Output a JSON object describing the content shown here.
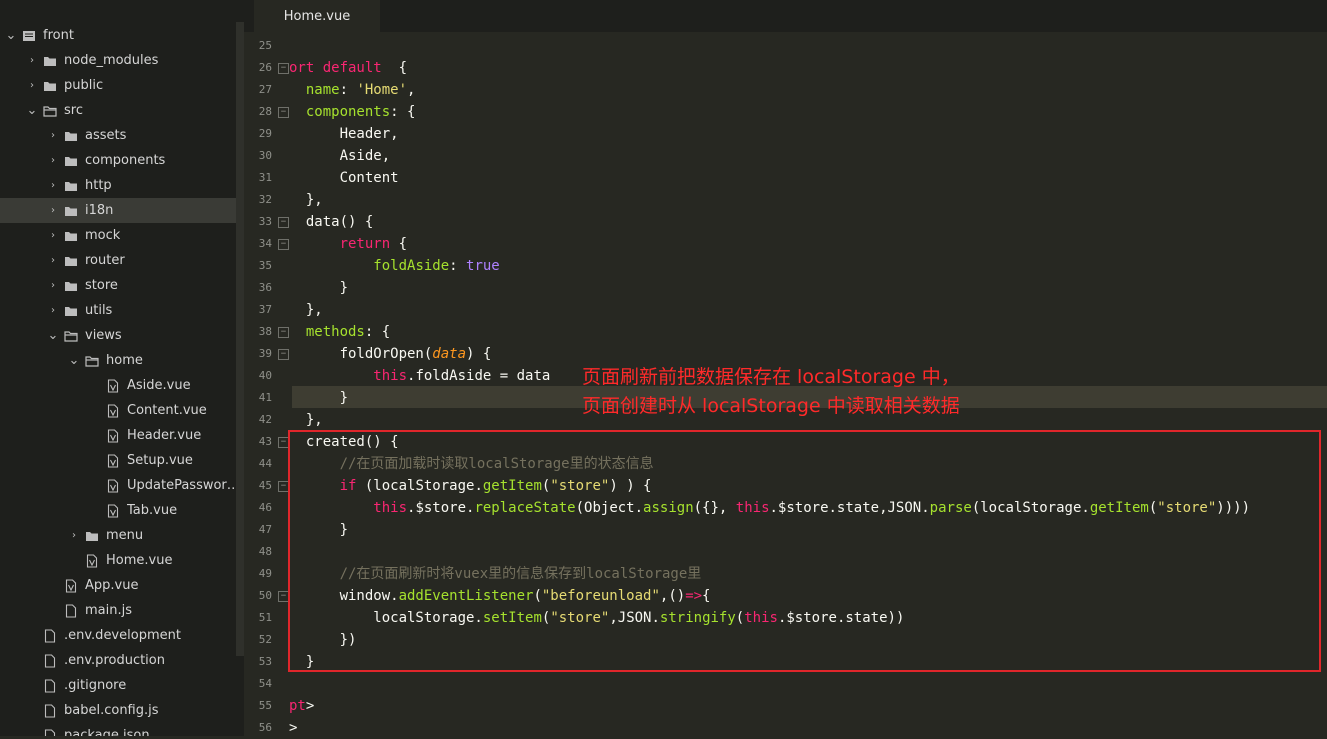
{
  "colors": {
    "annotation": "#ff2a2a",
    "highlight_box": "#e0262b",
    "editor_bg": "#272822",
    "sidebar_bg": "#1e1f1c"
  },
  "tab": {
    "label": "Home.vue"
  },
  "tree": [
    {
      "label": "front",
      "depth": 0,
      "expanded": true,
      "type": "root"
    },
    {
      "label": "node_modules",
      "depth": 1,
      "expanded": false,
      "type": "folder"
    },
    {
      "label": "public",
      "depth": 1,
      "expanded": false,
      "type": "folder"
    },
    {
      "label": "src",
      "depth": 1,
      "expanded": true,
      "type": "folder"
    },
    {
      "label": "assets",
      "depth": 2,
      "expanded": false,
      "type": "folder"
    },
    {
      "label": "components",
      "depth": 2,
      "expanded": false,
      "type": "folder"
    },
    {
      "label": "http",
      "depth": 2,
      "expanded": false,
      "type": "folder"
    },
    {
      "label": "i18n",
      "depth": 2,
      "expanded": false,
      "type": "folder",
      "selected": true
    },
    {
      "label": "mock",
      "depth": 2,
      "expanded": false,
      "type": "folder"
    },
    {
      "label": "router",
      "depth": 2,
      "expanded": false,
      "type": "folder"
    },
    {
      "label": "store",
      "depth": 2,
      "expanded": false,
      "type": "folder"
    },
    {
      "label": "utils",
      "depth": 2,
      "expanded": false,
      "type": "folder"
    },
    {
      "label": "views",
      "depth": 2,
      "expanded": true,
      "type": "folder"
    },
    {
      "label": "home",
      "depth": 3,
      "expanded": true,
      "type": "folder"
    },
    {
      "label": "Aside.vue",
      "depth": 4,
      "type": "vue"
    },
    {
      "label": "Content.vue",
      "depth": 4,
      "type": "vue"
    },
    {
      "label": "Header.vue",
      "depth": 4,
      "type": "vue"
    },
    {
      "label": "Setup.vue",
      "depth": 4,
      "type": "vue"
    },
    {
      "label": "UpdatePasswor…",
      "depth": 4,
      "type": "vue"
    },
    {
      "label": "Tab.vue",
      "depth": 4,
      "type": "vue"
    },
    {
      "label": "menu",
      "depth": 3,
      "expanded": false,
      "type": "folder"
    },
    {
      "label": "Home.vue",
      "depth": 3,
      "type": "vue"
    },
    {
      "label": "App.vue",
      "depth": 2,
      "type": "vue"
    },
    {
      "label": "main.js",
      "depth": 2,
      "type": "file"
    },
    {
      "label": ".env.development",
      "depth": 1,
      "type": "file"
    },
    {
      "label": ".env.production",
      "depth": 1,
      "type": "file"
    },
    {
      "label": ".gitignore",
      "depth": 1,
      "type": "file"
    },
    {
      "label": "babel.config.js",
      "depth": 1,
      "type": "file"
    },
    {
      "label": "package.json",
      "depth": 1,
      "type": "file"
    }
  ],
  "code_lines": [
    {
      "n": "25",
      "fold": false,
      "tokens": []
    },
    {
      "n": "26",
      "fold": true,
      "tokens": [
        [
          "kw",
          "ort default"
        ],
        [
          "",
          "  {"
        ]
      ]
    },
    {
      "n": "27",
      "fold": false,
      "tokens": [
        [
          "",
          "  "
        ],
        [
          "prop",
          "name"
        ],
        [
          "",
          ": "
        ],
        [
          "str",
          "'Home'"
        ],
        [
          "",
          ","
        ]
      ]
    },
    {
      "n": "28",
      "fold": true,
      "tokens": [
        [
          "",
          "  "
        ],
        [
          "prop",
          "components"
        ],
        [
          "",
          ": {"
        ]
      ]
    },
    {
      "n": "29",
      "fold": false,
      "tokens": [
        [
          "",
          "      Header,"
        ]
      ]
    },
    {
      "n": "30",
      "fold": false,
      "tokens": [
        [
          "",
          "      Aside,"
        ]
      ]
    },
    {
      "n": "31",
      "fold": false,
      "tokens": [
        [
          "",
          "      Content"
        ]
      ]
    },
    {
      "n": "32",
      "fold": false,
      "tokens": [
        [
          "",
          "  },"
        ]
      ]
    },
    {
      "n": "33",
      "fold": true,
      "tokens": [
        [
          "",
          "  data() {"
        ]
      ]
    },
    {
      "n": "34",
      "fold": true,
      "tokens": [
        [
          "",
          "      "
        ],
        [
          "kw",
          "return"
        ],
        [
          "",
          " {"
        ]
      ]
    },
    {
      "n": "35",
      "fold": false,
      "tokens": [
        [
          "",
          "          "
        ],
        [
          "prop",
          "foldAside"
        ],
        [
          "",
          ": "
        ],
        [
          "num",
          "true"
        ]
      ]
    },
    {
      "n": "36",
      "fold": false,
      "tokens": [
        [
          "",
          "      }"
        ]
      ]
    },
    {
      "n": "37",
      "fold": false,
      "tokens": [
        [
          "",
          "  },"
        ]
      ]
    },
    {
      "n": "38",
      "fold": true,
      "tokens": [
        [
          "",
          "  "
        ],
        [
          "prop",
          "methods"
        ],
        [
          "",
          ": {"
        ]
      ]
    },
    {
      "n": "39",
      "fold": true,
      "tokens": [
        [
          "",
          "      foldOrOpen("
        ],
        [
          "param",
          "data"
        ],
        [
          "",
          ") {"
        ]
      ]
    },
    {
      "n": "40",
      "fold": false,
      "tokens": [
        [
          "",
          "          "
        ],
        [
          "kw",
          "this"
        ],
        [
          "",
          ".foldAside = data"
        ]
      ]
    },
    {
      "n": "41",
      "fold": false,
      "tokens": [
        [
          "",
          "      }"
        ]
      ]
    },
    {
      "n": "42",
      "fold": false,
      "tokens": [
        [
          "",
          "  },"
        ]
      ]
    },
    {
      "n": "43",
      "fold": true,
      "tokens": [
        [
          "",
          "  created() {"
        ]
      ]
    },
    {
      "n": "44",
      "fold": false,
      "tokens": [
        [
          "",
          "      "
        ],
        [
          "cm",
          "//在页面加载时读取localStorage里的状态信息"
        ]
      ]
    },
    {
      "n": "45",
      "fold": true,
      "tokens": [
        [
          "",
          "      "
        ],
        [
          "kw",
          "if"
        ],
        [
          "",
          " (localStorage."
        ],
        [
          "fn",
          "getItem"
        ],
        [
          "",
          "("
        ],
        [
          "str",
          "\"store\""
        ],
        [
          "",
          ") ) {"
        ]
      ]
    },
    {
      "n": "46",
      "fold": false,
      "tokens": [
        [
          "",
          "          "
        ],
        [
          "kw",
          "this"
        ],
        [
          "",
          ".$store."
        ],
        [
          "fn",
          "replaceState"
        ],
        [
          "",
          "(Object."
        ],
        [
          "fn",
          "assign"
        ],
        [
          "",
          "({}, "
        ],
        [
          "kw",
          "this"
        ],
        [
          "",
          ".$store.state,JSON."
        ],
        [
          "fn",
          "parse"
        ],
        [
          "",
          "(localStorage."
        ],
        [
          "fn",
          "getItem"
        ],
        [
          "",
          "("
        ],
        [
          "str",
          "\"store\""
        ],
        [
          "",
          "))))"
        ]
      ]
    },
    {
      "n": "47",
      "fold": false,
      "tokens": [
        [
          "",
          "      }"
        ]
      ]
    },
    {
      "n": "48",
      "fold": false,
      "tokens": []
    },
    {
      "n": "49",
      "fold": false,
      "tokens": [
        [
          "",
          "      "
        ],
        [
          "cm",
          "//在页面刷新时将vuex里的信息保存到localStorage里"
        ]
      ]
    },
    {
      "n": "50",
      "fold": true,
      "tokens": [
        [
          "",
          "      window."
        ],
        [
          "fn",
          "addEventListener"
        ],
        [
          "",
          "("
        ],
        [
          "str",
          "\"beforeunload\""
        ],
        [
          "",
          ",()"
        ],
        [
          "kw",
          "=>"
        ],
        [
          "",
          "{"
        ]
      ]
    },
    {
      "n": "51",
      "fold": false,
      "tokens": [
        [
          "",
          "          localStorage."
        ],
        [
          "fn",
          "setItem"
        ],
        [
          "",
          "("
        ],
        [
          "str",
          "\"store\""
        ],
        [
          "",
          ",JSON."
        ],
        [
          "fn",
          "stringify"
        ],
        [
          "",
          "("
        ],
        [
          "kw",
          "this"
        ],
        [
          "",
          ".$store.state))"
        ]
      ]
    },
    {
      "n": "52",
      "fold": false,
      "tokens": [
        [
          "",
          "      })"
        ]
      ]
    },
    {
      "n": "53",
      "fold": false,
      "tokens": [
        [
          "",
          "  }"
        ]
      ]
    },
    {
      "n": "54",
      "fold": false,
      "tokens": []
    },
    {
      "n": "55",
      "fold": false,
      "tokens": [
        [
          "kw",
          "pt"
        ],
        [
          "",
          ">"
        ]
      ]
    },
    {
      "n": "56",
      "fold": false,
      "tokens": [
        [
          "kw",
          ""
        ],
        [
          "",
          ">"
        ]
      ]
    }
  ],
  "annotation": {
    "line1": "页面刷新前把数据保存在 localStorage 中，",
    "line2": "页面创建时从 localStorage 中读取相关数据"
  }
}
